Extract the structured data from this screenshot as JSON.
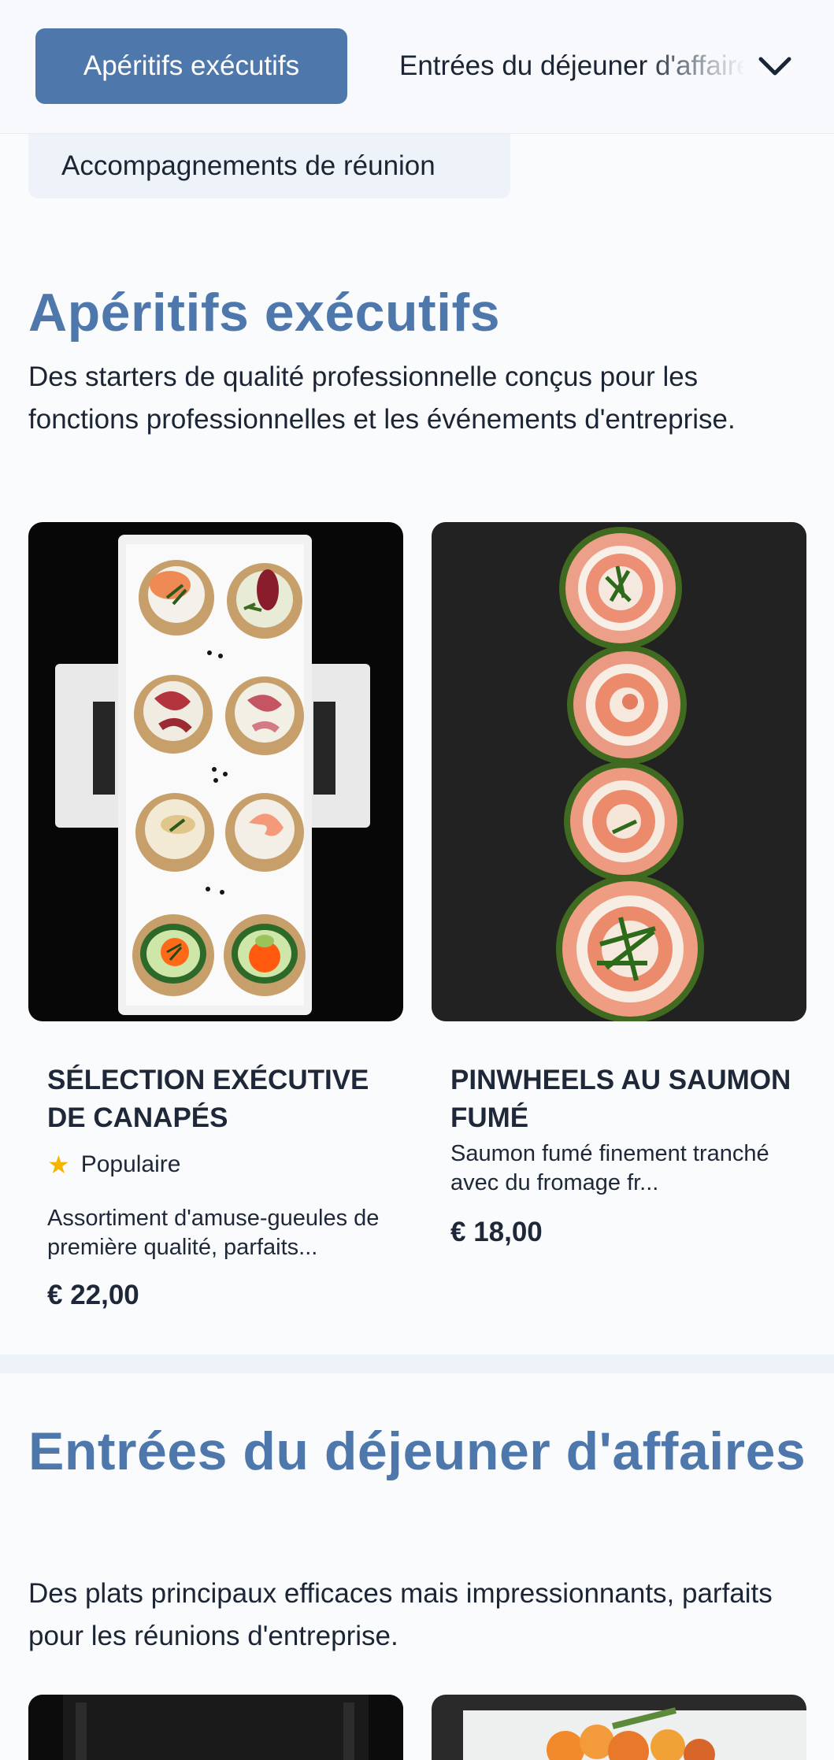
{
  "nav": {
    "active_tab": "Apéritifs exécutifs",
    "next_tab": "Entrées du déjeuner d'affaires",
    "row2_tab": "Accompagnements de réunion",
    "expand_icon": "chevron-down-icon"
  },
  "sections": [
    {
      "title": "Apéritifs exécutifs",
      "description": "Des starters de qualité professionnelle conçus pour les fonctions professionnelles et les événements d'entreprise.",
      "items": [
        {
          "name": "Sélection exécutive de canapés",
          "badge": "Populaire",
          "badge_icon": "star-icon",
          "description": "Assortiment d'amuse-gueules de première qualité, parfaits...",
          "price": "€ 22,00"
        },
        {
          "name": "Pinwheels au saumon fumé",
          "description": "Saumon fumé finement tranché avec du fromage fr...",
          "price": "€ 18,00"
        }
      ]
    },
    {
      "title": "Entrées du déjeuner d'affaires",
      "description": "Des plats principaux efficaces mais impressionnants, parfaits pour les réunions d'entreprise."
    }
  ],
  "colors": {
    "accent": "#4e78ac",
    "badge_star": "#f4b400",
    "background": "#fafbfd"
  }
}
